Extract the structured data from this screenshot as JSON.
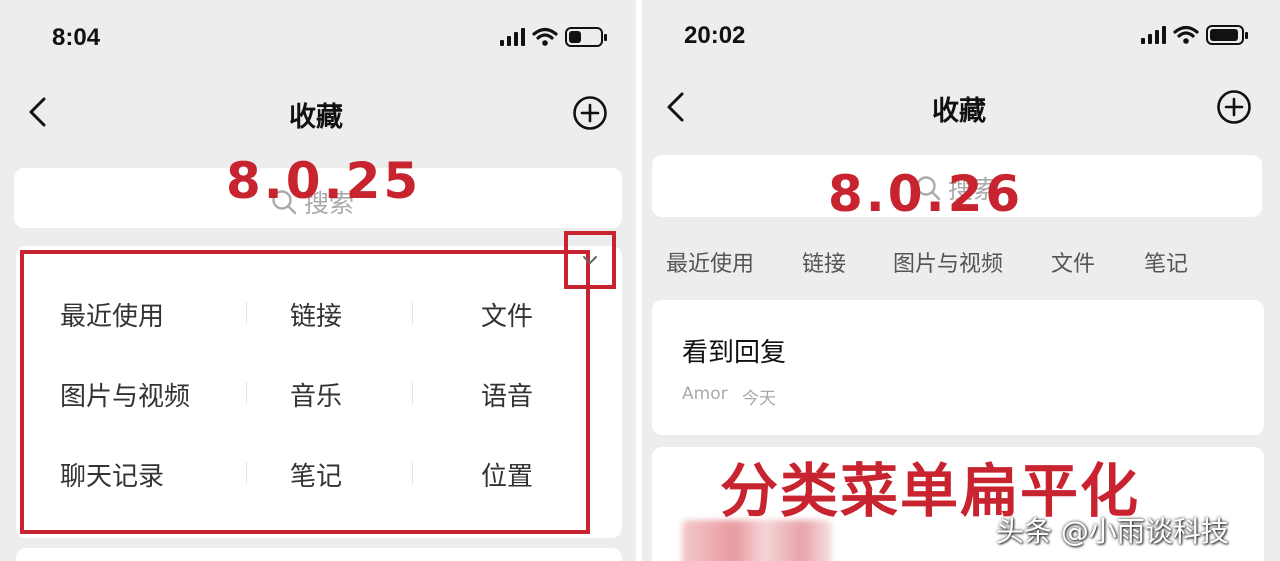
{
  "left": {
    "time": "8:04",
    "title": "收藏",
    "search_placeholder": "搜索",
    "version": "8.0.25",
    "categories": [
      [
        "最近使用",
        "链接",
        "文件"
      ],
      [
        "图片与视频",
        "音乐",
        "语音"
      ],
      [
        "聊天记录",
        "笔记",
        "位置"
      ]
    ]
  },
  "right": {
    "time": "20:02",
    "title": "收藏",
    "search_placeholder": "搜索",
    "version": "8.0.26",
    "tabs": [
      "最近使用",
      "链接",
      "图片与视频",
      "文件",
      "笔记"
    ],
    "item": {
      "title": "看到回复",
      "author": "Amor",
      "date": "今天"
    }
  },
  "overlay_title": "分类菜单扁平化",
  "watermark": "头条 @小雨谈科技",
  "icons": [
    "back-icon",
    "add-circle-icon",
    "search-icon",
    "chevron-down-icon",
    "signal-icon",
    "wifi-icon",
    "battery-icon"
  ],
  "colors": {
    "accent_red": "#c8242f",
    "background": "#ededed",
    "card": "#ffffff"
  }
}
